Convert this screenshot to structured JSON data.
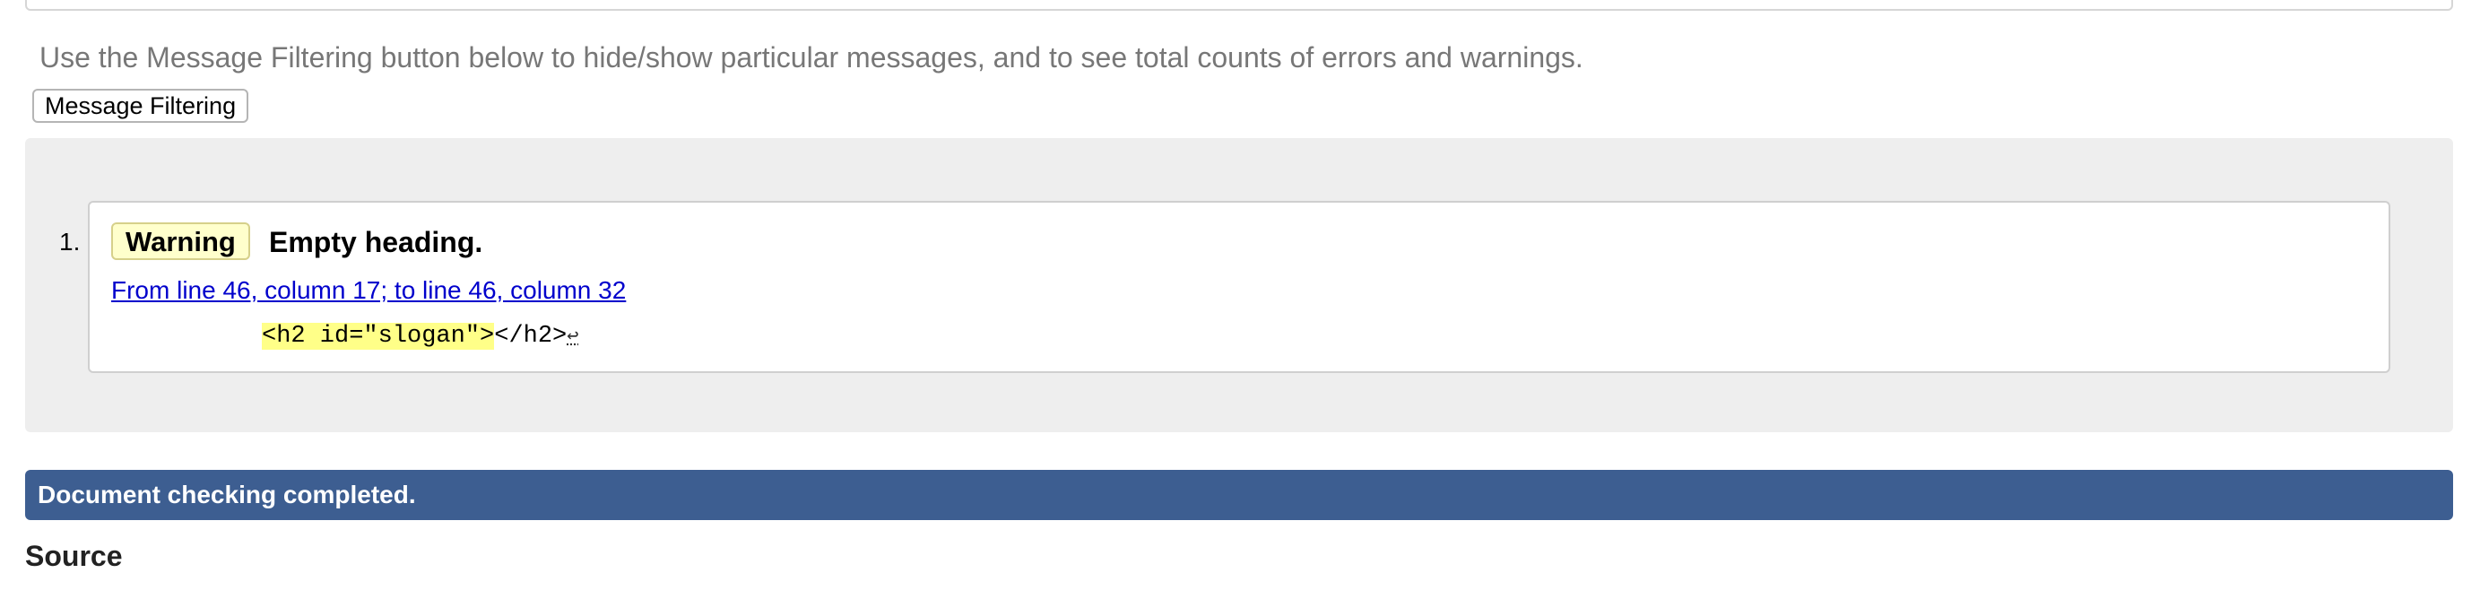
{
  "intro_text": "Use the Message Filtering button below to hide/show particular messages, and to see total counts of errors and warnings.",
  "filter_button_label": "Message Filtering",
  "messages": [
    {
      "number": "1.",
      "type_label": "Warning",
      "title": "Empty heading.",
      "location_link": "From line 46, column 17; to line 46, column 32",
      "code_highlight": "<h2 id=\"slogan\">",
      "code_rest": "</h2>",
      "code_return_glyph": "↩"
    }
  ],
  "status_text": "Document checking completed.",
  "section_heading": "Source",
  "colors": {
    "status_bar": "#3d5e91",
    "warning_badge": "#ffffcc",
    "code_highlight": "#ffff88",
    "link": "#0000cc"
  }
}
